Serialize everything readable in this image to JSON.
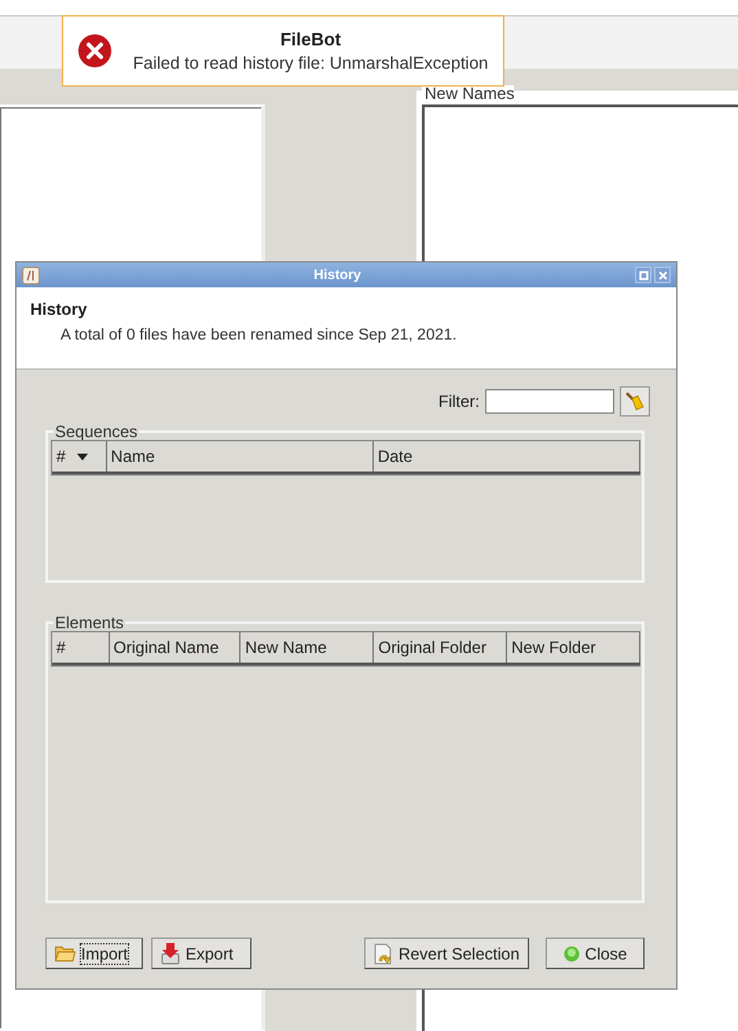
{
  "notification": {
    "title": "FileBot",
    "message": "Failed to read history file: UnmarshalException"
  },
  "background": {
    "panel_label": "New Names"
  },
  "dialog": {
    "title": "History",
    "heading": "History",
    "summary": "A total of 0 files have been renamed since Sep 21, 2021.",
    "filter": {
      "label": "Filter:"
    },
    "sequences": {
      "title": "Sequences",
      "columns": [
        {
          "label": "#",
          "sorted": true
        },
        {
          "label": "Name",
          "sorted": false
        },
        {
          "label": "Date",
          "sorted": false
        }
      ]
    },
    "elements": {
      "title": "Elements",
      "columns": [
        {
          "label": "#",
          "sorted": false
        },
        {
          "label": "Original Name",
          "sorted": false
        },
        {
          "label": "New Name",
          "sorted": false
        },
        {
          "label": "Original Folder",
          "sorted": false
        },
        {
          "label": "New Folder",
          "sorted": false
        }
      ]
    },
    "buttons": [
      {
        "label": "Import",
        "kind": "import",
        "focused": true
      },
      {
        "label": "Export",
        "kind": "export",
        "focused": false
      },
      {
        "label": "Revert Selection",
        "kind": "revert",
        "focused": false
      },
      {
        "label": "Close",
        "kind": "close",
        "focused": false
      }
    ]
  }
}
